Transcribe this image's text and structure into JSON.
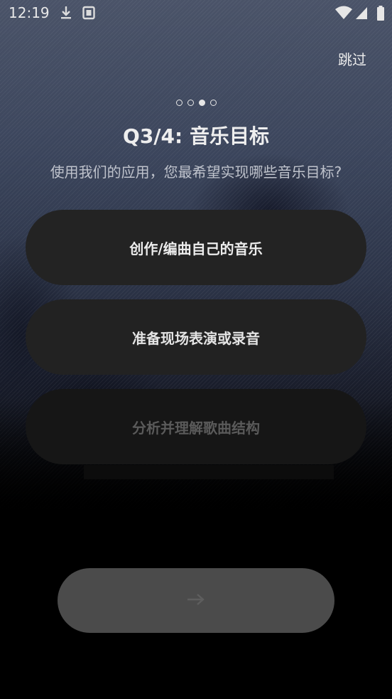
{
  "status_bar": {
    "time": "12:19",
    "icons": [
      "download-icon",
      "notification-app-icon",
      "wifi-icon",
      "signal-icon",
      "battery-icon"
    ]
  },
  "header": {
    "skip_label": "跳过"
  },
  "progress": {
    "total": 4,
    "current": 3
  },
  "question": {
    "title": "Q3/4: 音乐目标",
    "subtitle": "使用我们的应用，您最希望实现哪些音乐目标?"
  },
  "options": [
    {
      "label": "创作/编曲自己的音乐"
    },
    {
      "label": "准备现场表演或录音"
    },
    {
      "label": "分析并理解歌曲结构"
    }
  ],
  "footer": {
    "next_icon": "arrow-right-icon"
  },
  "colors": {
    "button_bg": "#232323",
    "next_bg": "#4b4b4b",
    "text": "#ececec"
  }
}
